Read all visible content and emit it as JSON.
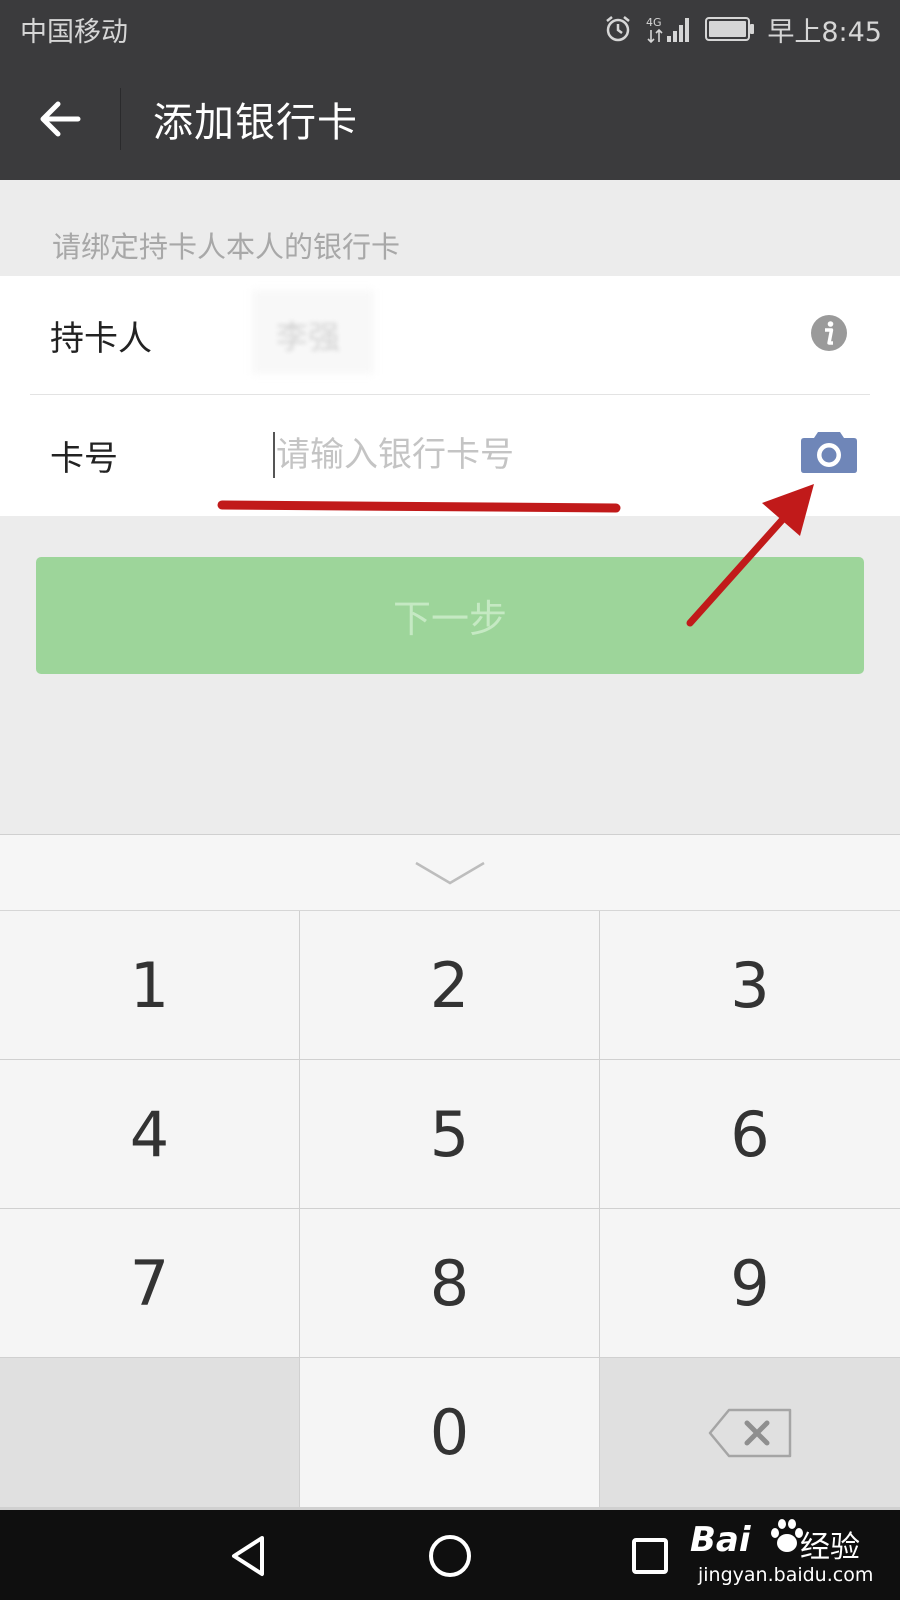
{
  "status_bar": {
    "carrier": "中国移动",
    "network": "4G",
    "time": "早上8:45"
  },
  "title_bar": {
    "back_icon": "arrow-left-icon",
    "title": "添加银行卡"
  },
  "form": {
    "hint": "请绑定持卡人本人的银行卡",
    "holder_label": "持卡人",
    "holder_value": "李强",
    "holder_info_icon": "info-icon",
    "card_label": "卡号",
    "card_placeholder": "请输入银行卡号",
    "card_value": "",
    "camera_icon": "camera-icon"
  },
  "next_button": {
    "label": "下一步",
    "enabled": false
  },
  "keyboard": {
    "collapse_icon": "chevron-down-icon",
    "keys": [
      "1",
      "2",
      "3",
      "4",
      "5",
      "6",
      "7",
      "8",
      "9",
      "",
      "0",
      "backspace"
    ]
  },
  "nav_bar": {
    "icons": [
      "triangle-back-icon",
      "circle-home-icon",
      "square-recent-icon"
    ]
  },
  "watermark": {
    "logo": "Bai",
    "name": "经验",
    "url": "jingyan.baidu.com"
  },
  "colors": {
    "header_bg": "#3b3b3d",
    "button_disabled": "#9dd59a",
    "camera_blue": "#6f86b8",
    "annotation_red": "#c11a1a"
  }
}
